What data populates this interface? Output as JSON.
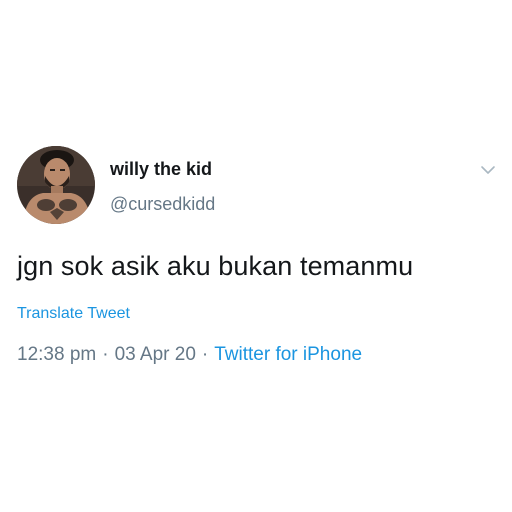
{
  "tweet": {
    "author": {
      "display_name": "willy the kid",
      "handle": "@cursedkidd",
      "avatar_icon": "user-avatar"
    },
    "menu_icon": "chevron-down-icon",
    "text": "jgn sok asik aku bukan temanmu",
    "translate_label": "Translate Tweet",
    "meta": {
      "time": "12:38 pm",
      "separator": "·",
      "date": "03 Apr 20",
      "client": "Twitter for iPhone"
    },
    "colors": {
      "text": "#14171a",
      "secondary": "#657786",
      "link": "#1b95e0"
    }
  }
}
